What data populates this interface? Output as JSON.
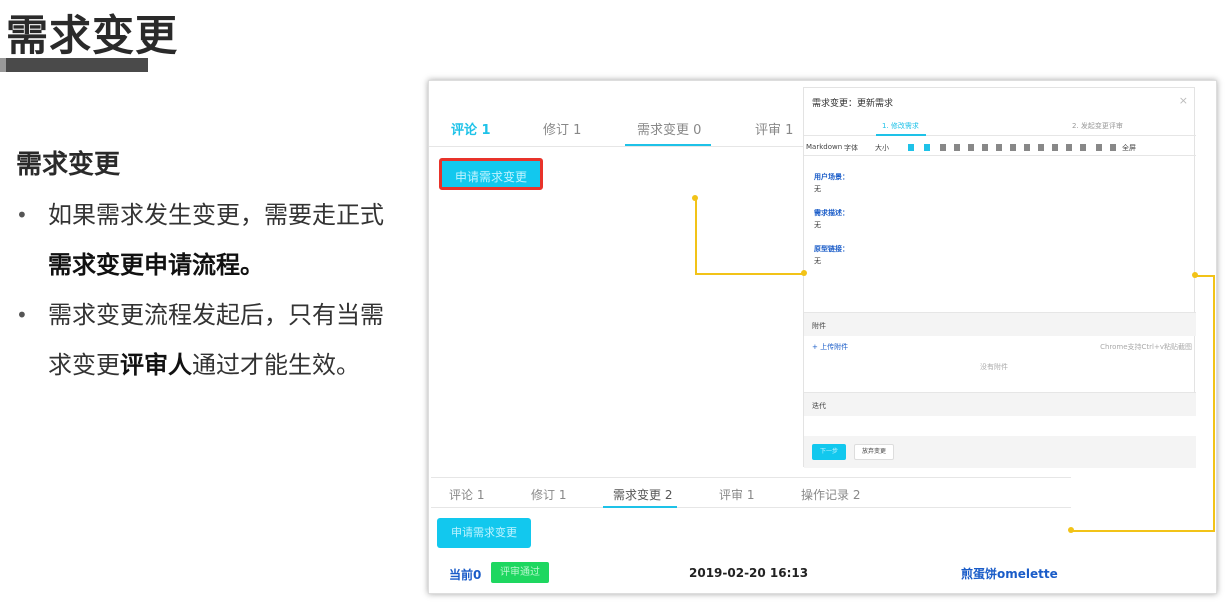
{
  "slide": {
    "title": "需求变更",
    "section_heading": "需求变更",
    "bullets": [
      {
        "pre": "如果需求发生变更，需要走正式",
        "bold": "需求变更申请流程。",
        "post": ""
      },
      {
        "pre": "需求变更流程发起后，只有当需求变更",
        "bold": "评审人",
        "post": "通过才能生效。"
      }
    ]
  },
  "top_panel": {
    "tabs": [
      "评论 1",
      "修订 1",
      "需求变更 0",
      "评审 1"
    ],
    "active_tab": "评论 1",
    "apply_button": "申请需求变更"
  },
  "dialog": {
    "title": "需求变更：更新需求",
    "close": "×",
    "steps": [
      "1. 修改需求",
      "2. 发起变更评审"
    ],
    "toolbar": {
      "markdown": "Markdown",
      "font": "字体",
      "size": "大小",
      "fullscreen": "全屏"
    },
    "fields": [
      {
        "label": "用户场景：",
        "value": "无"
      },
      {
        "label": "需求描述：",
        "value": "无"
      },
      {
        "label": "原型链接：",
        "value": "无"
      }
    ],
    "attachments_label": "附件",
    "upload_link": "+ 上传附件",
    "paste_hint": "Chrome支持Ctrl+v粘贴截图",
    "no_attachments": "没有附件",
    "iteration_label": "迭代",
    "next_button": "下一步",
    "discard_button": "放弃变更"
  },
  "bottom_panel": {
    "tabs": [
      "评论 1",
      "修订 1",
      "需求变更 2",
      "评审 1",
      "操作记录 2"
    ],
    "active_tab": "需求变更 2",
    "apply_button": "申请需求变更",
    "current_label": "当前0",
    "review_badge": "评审通过",
    "timestamp": "2019-02-20 16:13",
    "username": "煎蛋饼omelette"
  },
  "colors": {
    "accent": "#1ec2e8",
    "button": "#12c8ee",
    "highlight_border": "#e8332a",
    "connector": "#f2c318",
    "success": "#1ed760",
    "link": "#1a5cc8"
  }
}
